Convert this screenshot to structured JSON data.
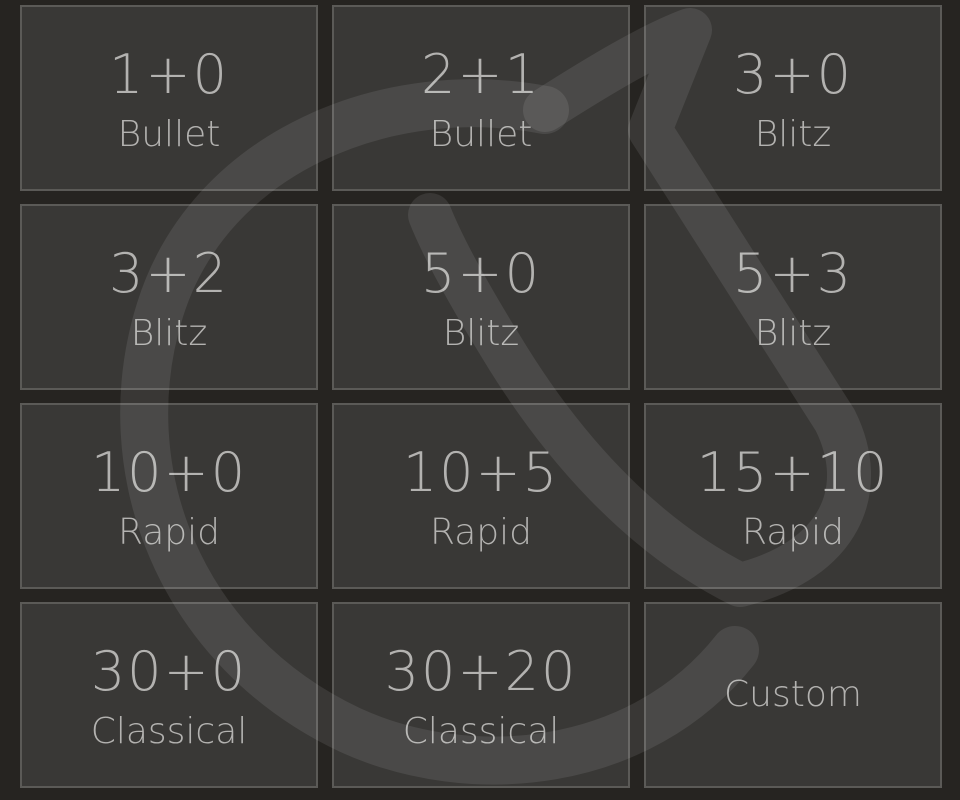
{
  "pools": [
    {
      "clock": "1+0",
      "perf": "Bullet"
    },
    {
      "clock": "2+1",
      "perf": "Bullet"
    },
    {
      "clock": "3+0",
      "perf": "Blitz"
    },
    {
      "clock": "3+2",
      "perf": "Blitz"
    },
    {
      "clock": "5+0",
      "perf": "Blitz"
    },
    {
      "clock": "5+3",
      "perf": "Blitz"
    },
    {
      "clock": "10+0",
      "perf": "Rapid"
    },
    {
      "clock": "10+5",
      "perf": "Rapid"
    },
    {
      "clock": "15+10",
      "perf": "Rapid"
    },
    {
      "clock": "30+0",
      "perf": "Classical"
    },
    {
      "clock": "30+20",
      "perf": "Classical"
    }
  ],
  "custom": {
    "label": "Custom"
  },
  "colors": {
    "background": "#262421",
    "tile": "#393836",
    "tile_border": "#5b5a57",
    "text": "#b3b2b0",
    "watermark": "#ffffff"
  },
  "watermark": {
    "icon": "lichess-knight-logo"
  }
}
